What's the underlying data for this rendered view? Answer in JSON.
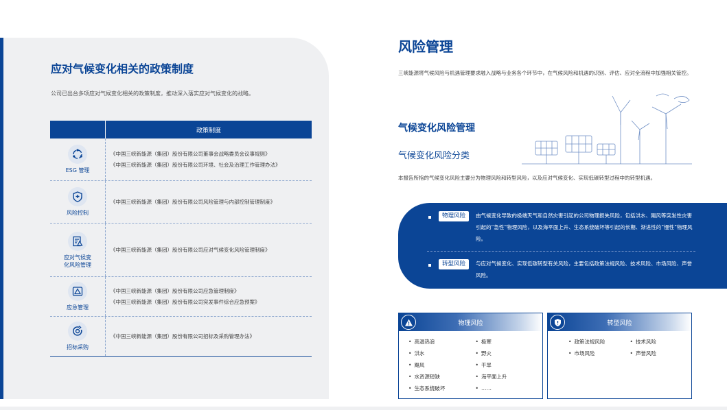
{
  "left": {
    "title": "应对气候变化相关的政策制度",
    "intro": "公司已出台多项应对气候变化相关的政策制度，推动深入落实应对气候变化的战略。",
    "table_header": "政策制度",
    "rows": [
      {
        "category": "ESG 管理",
        "icon": "esg-cycle-icon",
        "items": [
          "《中国三峡新能源（集团）股份有限公司董事会战略委员会议事规则》",
          "《中国三峡新能源（集团）股份有限公司环境、社会及治理工作管理办法》"
        ]
      },
      {
        "category": "风险控制",
        "icon": "shield-icon",
        "items": [
          "《中国三峡新能源（集团）股份有限公司风险管理与内部控制管理制度》"
        ]
      },
      {
        "category": "应对气候变化风险管理",
        "icon": "climate-document-icon",
        "items": [
          "《中国三峡新能源（集团）股份有限公司应对气候变化风险管理制度》"
        ]
      },
      {
        "category": "应急管理",
        "icon": "warning-triangle-icon",
        "items": [
          "《中国三峡新能源（集团）股份有限公司应急管理制度》",
          "《中国三峡新能源（集团）股份有限公司突发事件综合应急预案》"
        ]
      },
      {
        "category": "招标采购",
        "icon": "target-refresh-icon",
        "items": [
          "《中国三峡新能源（集团）股份有限公司招标及采购管理办法》"
        ]
      }
    ]
  },
  "right": {
    "title": "风险管理",
    "intro": "三峡能源将气候风险与机遇管理要求融入战略与业务各个环节中，在气候风险和机遇的识别、评估、应对全流程中加强相关管控。",
    "subtitle_1": "气候变化风险管理",
    "subtitle_2": "气候变化风险分类",
    "classification": "本报告所指的气候变化风险主要分为物理风险和转型风险，以及应对气候变化、实现低碳转型过程中的转型机遇。",
    "risks": [
      {
        "tag": "物理风险",
        "description": "由气候变化导致的极端天气和自然灾害引起的公司物理损失风险，包括洪水、飓风等突发性灾害引起的“急性”物理风险，以及海平面上升、生态系统破坏等引起的长期、渐进性的“慢性”物理风险。"
      },
      {
        "tag": "转型风险",
        "description": "与应对气候变化、实现低碳转型有关风险，主要包括政策法规风险、技术风险、市场风险、声誉风险。"
      }
    ],
    "physical_card": {
      "title": "物理风险",
      "icon": "alert-triangle-icon",
      "items": [
        "高温热浪",
        "极寒",
        "洪水",
        "野火",
        "飓风",
        "干旱",
        "水资源短缺",
        "海平面上升",
        "生态系统破坏",
        "……"
      ]
    },
    "transition_card": {
      "title": "转型风险",
      "icon": "shield-alert-icon",
      "items": [
        "政策法规风险",
        "技术风险",
        "市场风险",
        "声誉风险"
      ]
    }
  },
  "colors": {
    "brand_blue": "#0b4596",
    "panel_gray": "#eff0f2"
  }
}
